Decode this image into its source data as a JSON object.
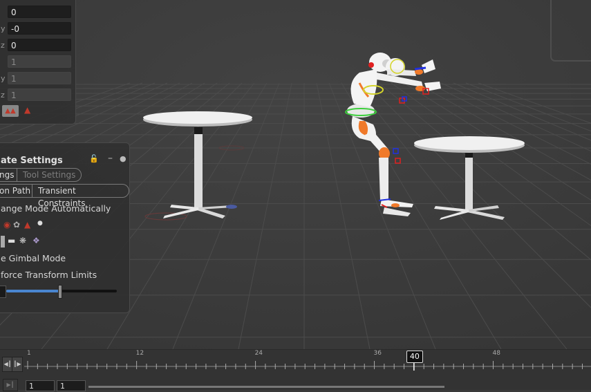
{
  "transform": {
    "rows": [
      {
        "axis": "",
        "value": "0",
        "disabled": false
      },
      {
        "axis": "y",
        "value": "-0",
        "disabled": false
      },
      {
        "axis": "z",
        "value": "0",
        "disabled": false
      },
      {
        "axis": "",
        "value": "1",
        "disabled": true
      },
      {
        "axis": "y",
        "value": "1",
        "disabled": true
      },
      {
        "axis": "z",
        "value": "1",
        "disabled": true
      }
    ]
  },
  "state_panel": {
    "title": "ate Settings",
    "tabs": {
      "settings": "ngs",
      "tool_settings": "Tool Settings"
    },
    "subtabs": {
      "path": "on Path",
      "transient": "Transient Constraints"
    },
    "change_mode": "ange Mode Automatically",
    "gimbal_mode": "e Gimbal Mode",
    "enforce_limits": "force Transform Limits",
    "slider_value": 0.48
  },
  "timeline": {
    "ticks": [
      {
        "frame": 1,
        "label": "1"
      },
      {
        "frame": 12,
        "label": "12"
      },
      {
        "frame": 24,
        "label": "24"
      },
      {
        "frame": 36,
        "label": "36"
      },
      {
        "frame": 48,
        "label": "48"
      }
    ],
    "current_frame": "40",
    "range_start": "1",
    "range_end": "1"
  },
  "colors": {
    "accent": "#4a86d0",
    "robot_orange": "#f07a2a",
    "robot_white": "#f2f2f2"
  }
}
